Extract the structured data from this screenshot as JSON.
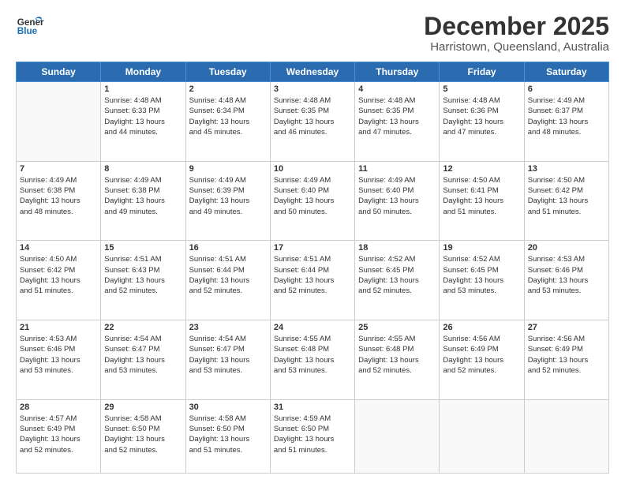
{
  "header": {
    "logo_line1": "General",
    "logo_line2": "Blue",
    "month": "December 2025",
    "location": "Harristown, Queensland, Australia"
  },
  "weekdays": [
    "Sunday",
    "Monday",
    "Tuesday",
    "Wednesday",
    "Thursday",
    "Friday",
    "Saturday"
  ],
  "weeks": [
    [
      {
        "day": "",
        "info": ""
      },
      {
        "day": "1",
        "info": "Sunrise: 4:48 AM\nSunset: 6:33 PM\nDaylight: 13 hours\nand 44 minutes."
      },
      {
        "day": "2",
        "info": "Sunrise: 4:48 AM\nSunset: 6:34 PM\nDaylight: 13 hours\nand 45 minutes."
      },
      {
        "day": "3",
        "info": "Sunrise: 4:48 AM\nSunset: 6:35 PM\nDaylight: 13 hours\nand 46 minutes."
      },
      {
        "day": "4",
        "info": "Sunrise: 4:48 AM\nSunset: 6:35 PM\nDaylight: 13 hours\nand 47 minutes."
      },
      {
        "day": "5",
        "info": "Sunrise: 4:48 AM\nSunset: 6:36 PM\nDaylight: 13 hours\nand 47 minutes."
      },
      {
        "day": "6",
        "info": "Sunrise: 4:49 AM\nSunset: 6:37 PM\nDaylight: 13 hours\nand 48 minutes."
      }
    ],
    [
      {
        "day": "7",
        "info": "Sunrise: 4:49 AM\nSunset: 6:38 PM\nDaylight: 13 hours\nand 48 minutes."
      },
      {
        "day": "8",
        "info": "Sunrise: 4:49 AM\nSunset: 6:38 PM\nDaylight: 13 hours\nand 49 minutes."
      },
      {
        "day": "9",
        "info": "Sunrise: 4:49 AM\nSunset: 6:39 PM\nDaylight: 13 hours\nand 49 minutes."
      },
      {
        "day": "10",
        "info": "Sunrise: 4:49 AM\nSunset: 6:40 PM\nDaylight: 13 hours\nand 50 minutes."
      },
      {
        "day": "11",
        "info": "Sunrise: 4:49 AM\nSunset: 6:40 PM\nDaylight: 13 hours\nand 50 minutes."
      },
      {
        "day": "12",
        "info": "Sunrise: 4:50 AM\nSunset: 6:41 PM\nDaylight: 13 hours\nand 51 minutes."
      },
      {
        "day": "13",
        "info": "Sunrise: 4:50 AM\nSunset: 6:42 PM\nDaylight: 13 hours\nand 51 minutes."
      }
    ],
    [
      {
        "day": "14",
        "info": "Sunrise: 4:50 AM\nSunset: 6:42 PM\nDaylight: 13 hours\nand 51 minutes."
      },
      {
        "day": "15",
        "info": "Sunrise: 4:51 AM\nSunset: 6:43 PM\nDaylight: 13 hours\nand 52 minutes."
      },
      {
        "day": "16",
        "info": "Sunrise: 4:51 AM\nSunset: 6:44 PM\nDaylight: 13 hours\nand 52 minutes."
      },
      {
        "day": "17",
        "info": "Sunrise: 4:51 AM\nSunset: 6:44 PM\nDaylight: 13 hours\nand 52 minutes."
      },
      {
        "day": "18",
        "info": "Sunrise: 4:52 AM\nSunset: 6:45 PM\nDaylight: 13 hours\nand 52 minutes."
      },
      {
        "day": "19",
        "info": "Sunrise: 4:52 AM\nSunset: 6:45 PM\nDaylight: 13 hours\nand 53 minutes."
      },
      {
        "day": "20",
        "info": "Sunrise: 4:53 AM\nSunset: 6:46 PM\nDaylight: 13 hours\nand 53 minutes."
      }
    ],
    [
      {
        "day": "21",
        "info": "Sunrise: 4:53 AM\nSunset: 6:46 PM\nDaylight: 13 hours\nand 53 minutes."
      },
      {
        "day": "22",
        "info": "Sunrise: 4:54 AM\nSunset: 6:47 PM\nDaylight: 13 hours\nand 53 minutes."
      },
      {
        "day": "23",
        "info": "Sunrise: 4:54 AM\nSunset: 6:47 PM\nDaylight: 13 hours\nand 53 minutes."
      },
      {
        "day": "24",
        "info": "Sunrise: 4:55 AM\nSunset: 6:48 PM\nDaylight: 13 hours\nand 53 minutes."
      },
      {
        "day": "25",
        "info": "Sunrise: 4:55 AM\nSunset: 6:48 PM\nDaylight: 13 hours\nand 52 minutes."
      },
      {
        "day": "26",
        "info": "Sunrise: 4:56 AM\nSunset: 6:49 PM\nDaylight: 13 hours\nand 52 minutes."
      },
      {
        "day": "27",
        "info": "Sunrise: 4:56 AM\nSunset: 6:49 PM\nDaylight: 13 hours\nand 52 minutes."
      }
    ],
    [
      {
        "day": "28",
        "info": "Sunrise: 4:57 AM\nSunset: 6:49 PM\nDaylight: 13 hours\nand 52 minutes."
      },
      {
        "day": "29",
        "info": "Sunrise: 4:58 AM\nSunset: 6:50 PM\nDaylight: 13 hours\nand 52 minutes."
      },
      {
        "day": "30",
        "info": "Sunrise: 4:58 AM\nSunset: 6:50 PM\nDaylight: 13 hours\nand 51 minutes."
      },
      {
        "day": "31",
        "info": "Sunrise: 4:59 AM\nSunset: 6:50 PM\nDaylight: 13 hours\nand 51 minutes."
      },
      {
        "day": "",
        "info": ""
      },
      {
        "day": "",
        "info": ""
      },
      {
        "day": "",
        "info": ""
      }
    ]
  ]
}
